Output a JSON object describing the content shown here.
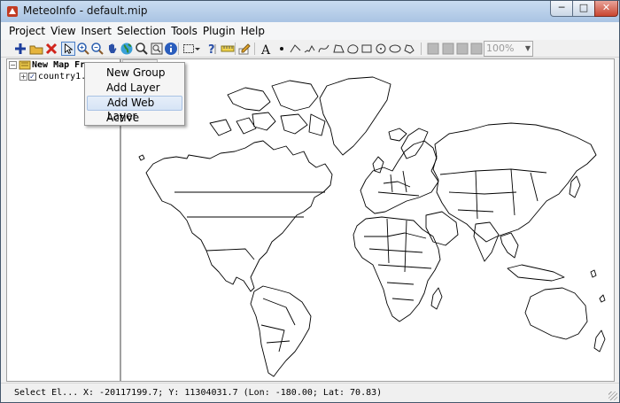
{
  "window": {
    "title": "MeteoInfo - default.mip",
    "controls": {
      "minimize": "─",
      "maximize": "□",
      "close": "✕"
    }
  },
  "menubar": [
    "Project",
    "View",
    "Insert",
    "Selection",
    "Tools",
    "Plugin",
    "Help"
  ],
  "toolbar": {
    "icons": [
      "add-layer-icon",
      "open-project-icon",
      "remove-layer-icon",
      "select-pointer-icon",
      "zoom-in-icon",
      "zoom-out-icon",
      "pan-hand-icon",
      "full-extent-globe-icon",
      "zoom-tool-icon",
      "zoom-layer-icon",
      "identify-info-icon",
      "select-features-icon",
      "dropdown-arrow-icon",
      "help-query-icon",
      "measure-icon",
      "edit-pencil-icon",
      "text-tool-icon",
      "point-tool-icon",
      "polyline-icon",
      "freehand-icon",
      "curve-icon",
      "polygon-icon",
      "curve-polygon-icon",
      "rectangle-icon",
      "circle-icon",
      "ellipse-icon",
      "freehand-polygon-icon",
      "layout-icon-1",
      "layout-icon-2",
      "layout-icon-3",
      "layout-icon-4"
    ],
    "zoom": "100%"
  },
  "legend": {
    "map_frame": "New Map Fra",
    "layer": "country1.sh"
  },
  "context_menu": {
    "items": [
      "New Group",
      "Add Layer",
      "Add Web Layer",
      "Active"
    ],
    "highlighted": "Add Web Layer"
  },
  "status": {
    "mode": "Select El...",
    "coords": "X: -20117199.7; Y: 11304031.7 (Lon: -180.00; Lat: 70.83)"
  },
  "colors": {
    "titlebar": "#b7cfe9",
    "map_background": "#ffffff",
    "map_lines": "#000000",
    "highlight": "#d6e4f6"
  }
}
